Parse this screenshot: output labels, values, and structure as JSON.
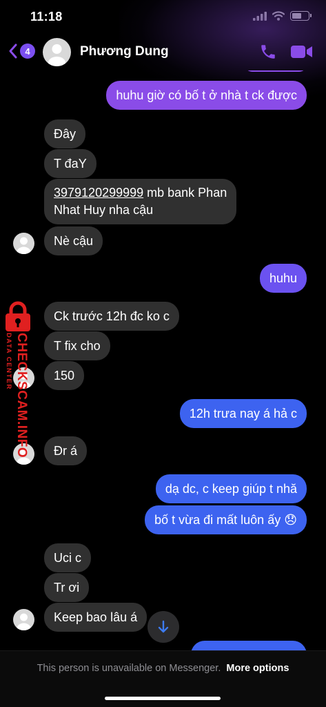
{
  "status_bar": {
    "time": "11:18"
  },
  "header": {
    "unread_count": "4",
    "contact_name": "Phương Dung"
  },
  "messages": [
    {
      "direction": "outgoing",
      "text": "huhu giờ có bố t ở nhà t ck được",
      "color": "#8a4ce8"
    },
    {
      "direction": "incoming",
      "text": "Đây"
    },
    {
      "direction": "incoming",
      "text": "T đaY"
    },
    {
      "direction": "incoming",
      "account_number": "3979120299999",
      "text_1": " mb bank Phan",
      "text_2": "Nhat Huy nha cậu"
    },
    {
      "direction": "incoming",
      "text": "Nè cậu"
    },
    {
      "direction": "outgoing",
      "text": "huhu",
      "color": "#6b52f0"
    },
    {
      "direction": "incoming",
      "text": "Ck trước 12h đc ko c"
    },
    {
      "direction": "incoming",
      "text": "T fix cho"
    },
    {
      "direction": "incoming",
      "text": "150"
    },
    {
      "direction": "outgoing",
      "text": "12h trưa nay á hả c",
      "color": "#3d63f0"
    },
    {
      "direction": "incoming",
      "text": "Đr á"
    },
    {
      "direction": "outgoing",
      "text": "dạ dc, c keep giúp t nhă",
      "color": "#3d63f0"
    },
    {
      "direction": "outgoing",
      "text": "bố t vừa đi mất luôn ấy",
      "emoji": "😞",
      "color": "#3d63f0"
    },
    {
      "direction": "incoming",
      "text": "Uci c"
    },
    {
      "direction": "incoming",
      "text": "Tr ơi"
    },
    {
      "direction": "incoming",
      "text": "Keep bao lâu á"
    }
  ],
  "footer": {
    "notice": "This person is unavailable on Messenger.",
    "action": "More options"
  },
  "watermark": {
    "main": "CHECKSCAM.INFO",
    "sub": "DATA CENTER"
  },
  "colors": {
    "accent": "#8a4ce8",
    "incoming_bubble": "#303030",
    "outgoing_blue": "#3d63f0",
    "watermark": "#e02020"
  }
}
